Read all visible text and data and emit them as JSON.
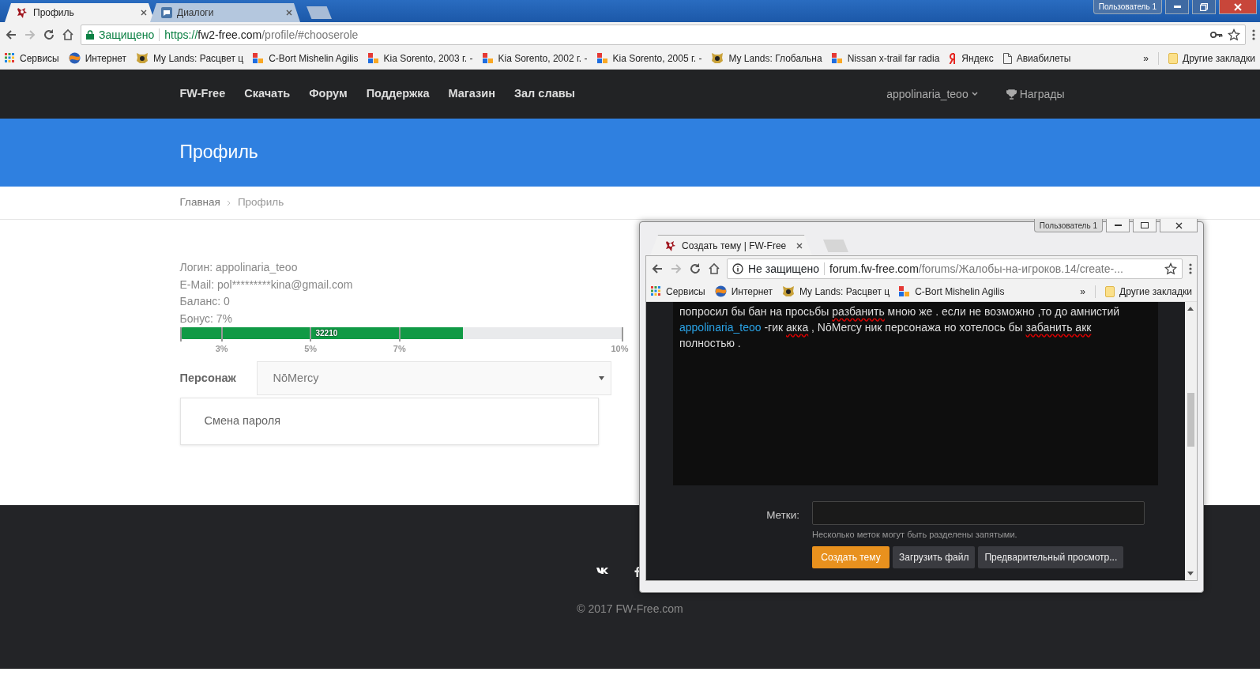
{
  "browser": {
    "tabs": [
      {
        "title": "Профиль",
        "selected": true
      },
      {
        "title": "Диалоги",
        "selected": false
      }
    ],
    "user_button": "Пользователь 1",
    "address": {
      "secure_label": "Защищено",
      "scheme": "https://",
      "host": "fw2-free.com",
      "path": "/profile/#chooserole"
    },
    "bookmarks": [
      {
        "kind": "apps",
        "label": "Сервисы"
      },
      {
        "kind": "globe",
        "label": "Интернет"
      },
      {
        "kind": "game",
        "label": "My Lands: Расцвет ц"
      },
      {
        "kind": "squares",
        "label": "C-Bort Mishelin Agilis"
      },
      {
        "kind": "squares",
        "label": "Kia Sorento, 2003 г. -"
      },
      {
        "kind": "squares",
        "label": "Kia Sorento, 2002 г. -"
      },
      {
        "kind": "squares",
        "label": "Kia Sorento, 2005 г. -"
      },
      {
        "kind": "game",
        "label": "My Lands: Глобальна"
      },
      {
        "kind": "squares",
        "label": "Nissan x-trail far radia"
      },
      {
        "kind": "yandex",
        "label": "Яндекс"
      },
      {
        "kind": "page",
        "label": "Авиабилеты"
      }
    ],
    "bookmarks_overflow": "»",
    "other_bookmarks": "Другие закладки"
  },
  "site": {
    "brand": "FW-Free",
    "nav": [
      "Скачать",
      "Форум",
      "Поддержка",
      "Магазин",
      "Зал славы"
    ],
    "user": "appolinaria_teoo",
    "awards": "Награды"
  },
  "header": {
    "title": "Профиль"
  },
  "breadcrumb": [
    {
      "label": "Главная",
      "current": false
    },
    {
      "label": "Профиль",
      "current": true
    }
  ],
  "profile": {
    "lines": [
      "Логин: appolinaria_teoo",
      "E-Mail: pol*********kina@gmail.com",
      "Баланс: 0",
      "Бонус: 7%"
    ],
    "progress": {
      "level": 0.64,
      "label": "32210",
      "ticks": [
        "3%",
        "5%",
        "7%",
        "10%"
      ]
    },
    "character": {
      "label": "Персонаж",
      "value": "NōMercy"
    },
    "card": "Смена пароля"
  },
  "footer": {
    "copyright": "© 2017 FW-Free.com"
  },
  "popup": {
    "tab": {
      "title": "Создать тему | FW-Free",
      "selected": true
    },
    "user_button": "Пользователь 1",
    "address": {
      "security_label": "Не защищено",
      "host": "forum.fw-free.com",
      "path": "/forums/Жалобы-на-игроков.14/create-..."
    },
    "bookmarks": [
      {
        "kind": "apps",
        "label": "Сервисы"
      },
      {
        "kind": "globe",
        "label": "Интернет"
      },
      {
        "kind": "game",
        "label": "My Lands: Расцвет ц"
      },
      {
        "kind": "squares",
        "label": "C-Bort Mishelin Agilis"
      }
    ],
    "bookmarks_overflow": "»",
    "other_bookmarks": "Другие закладки",
    "editor_lines": [
      [
        {
          "kind": "text",
          "text": "попросил бы бан на просьбы "
        },
        {
          "kind": "misspelled",
          "text": "разбанить"
        },
        {
          "kind": "text",
          "text": " мною же . если не возможно ,то до амнистий"
        }
      ],
      [
        {
          "kind": "link",
          "text": "appolinaria_teoo"
        },
        {
          "kind": "text",
          "text": " -гик "
        },
        {
          "kind": "misspelled",
          "text": "акка"
        },
        {
          "kind": "text",
          "text": " , NōMercy ник персонажа но хотелось бы "
        },
        {
          "kind": "misspelled",
          "text": "забанить акк"
        }
      ],
      [
        {
          "kind": "text",
          "text": "полностью ."
        }
      ]
    ],
    "tags": {
      "label": "Метки:",
      "hint": "Несколько меток могут быть разделены запятыми."
    },
    "buttons": [
      {
        "label": "Создать тему",
        "kind": "primary"
      },
      {
        "label": "Загрузить файл",
        "kind": "secondary"
      },
      {
        "label": "Предварительный просмотр...",
        "kind": "secondary"
      }
    ]
  }
}
